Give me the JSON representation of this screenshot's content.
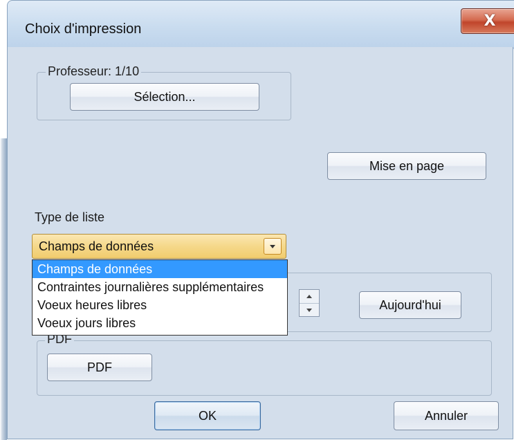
{
  "window": {
    "title": "Choix d'impression",
    "close_glyph": "X"
  },
  "professeur_group": {
    "legend": "Professeur: 1/10",
    "selection_button": "Sélection..."
  },
  "mise_en_page_button": "Mise en page",
  "type_liste": {
    "label": "Type de liste",
    "selected": "Champs de données",
    "options": [
      "Champs de données",
      "Contraintes journalières supplémentaires",
      "Voeux heures libres",
      "Voeux jours libres"
    ]
  },
  "date_group": {
    "today_button": "Aujourd'hui"
  },
  "pdf_group": {
    "legend": "PDF",
    "pdf_button": "PDF"
  },
  "footer": {
    "ok_button": "OK",
    "cancel_button": "Annuler"
  },
  "colors": {
    "client_bg": "#d3deeb",
    "combo_bg": "#f5d88a",
    "selection_blue": "#3399ff",
    "close_red": "#c0452b"
  }
}
